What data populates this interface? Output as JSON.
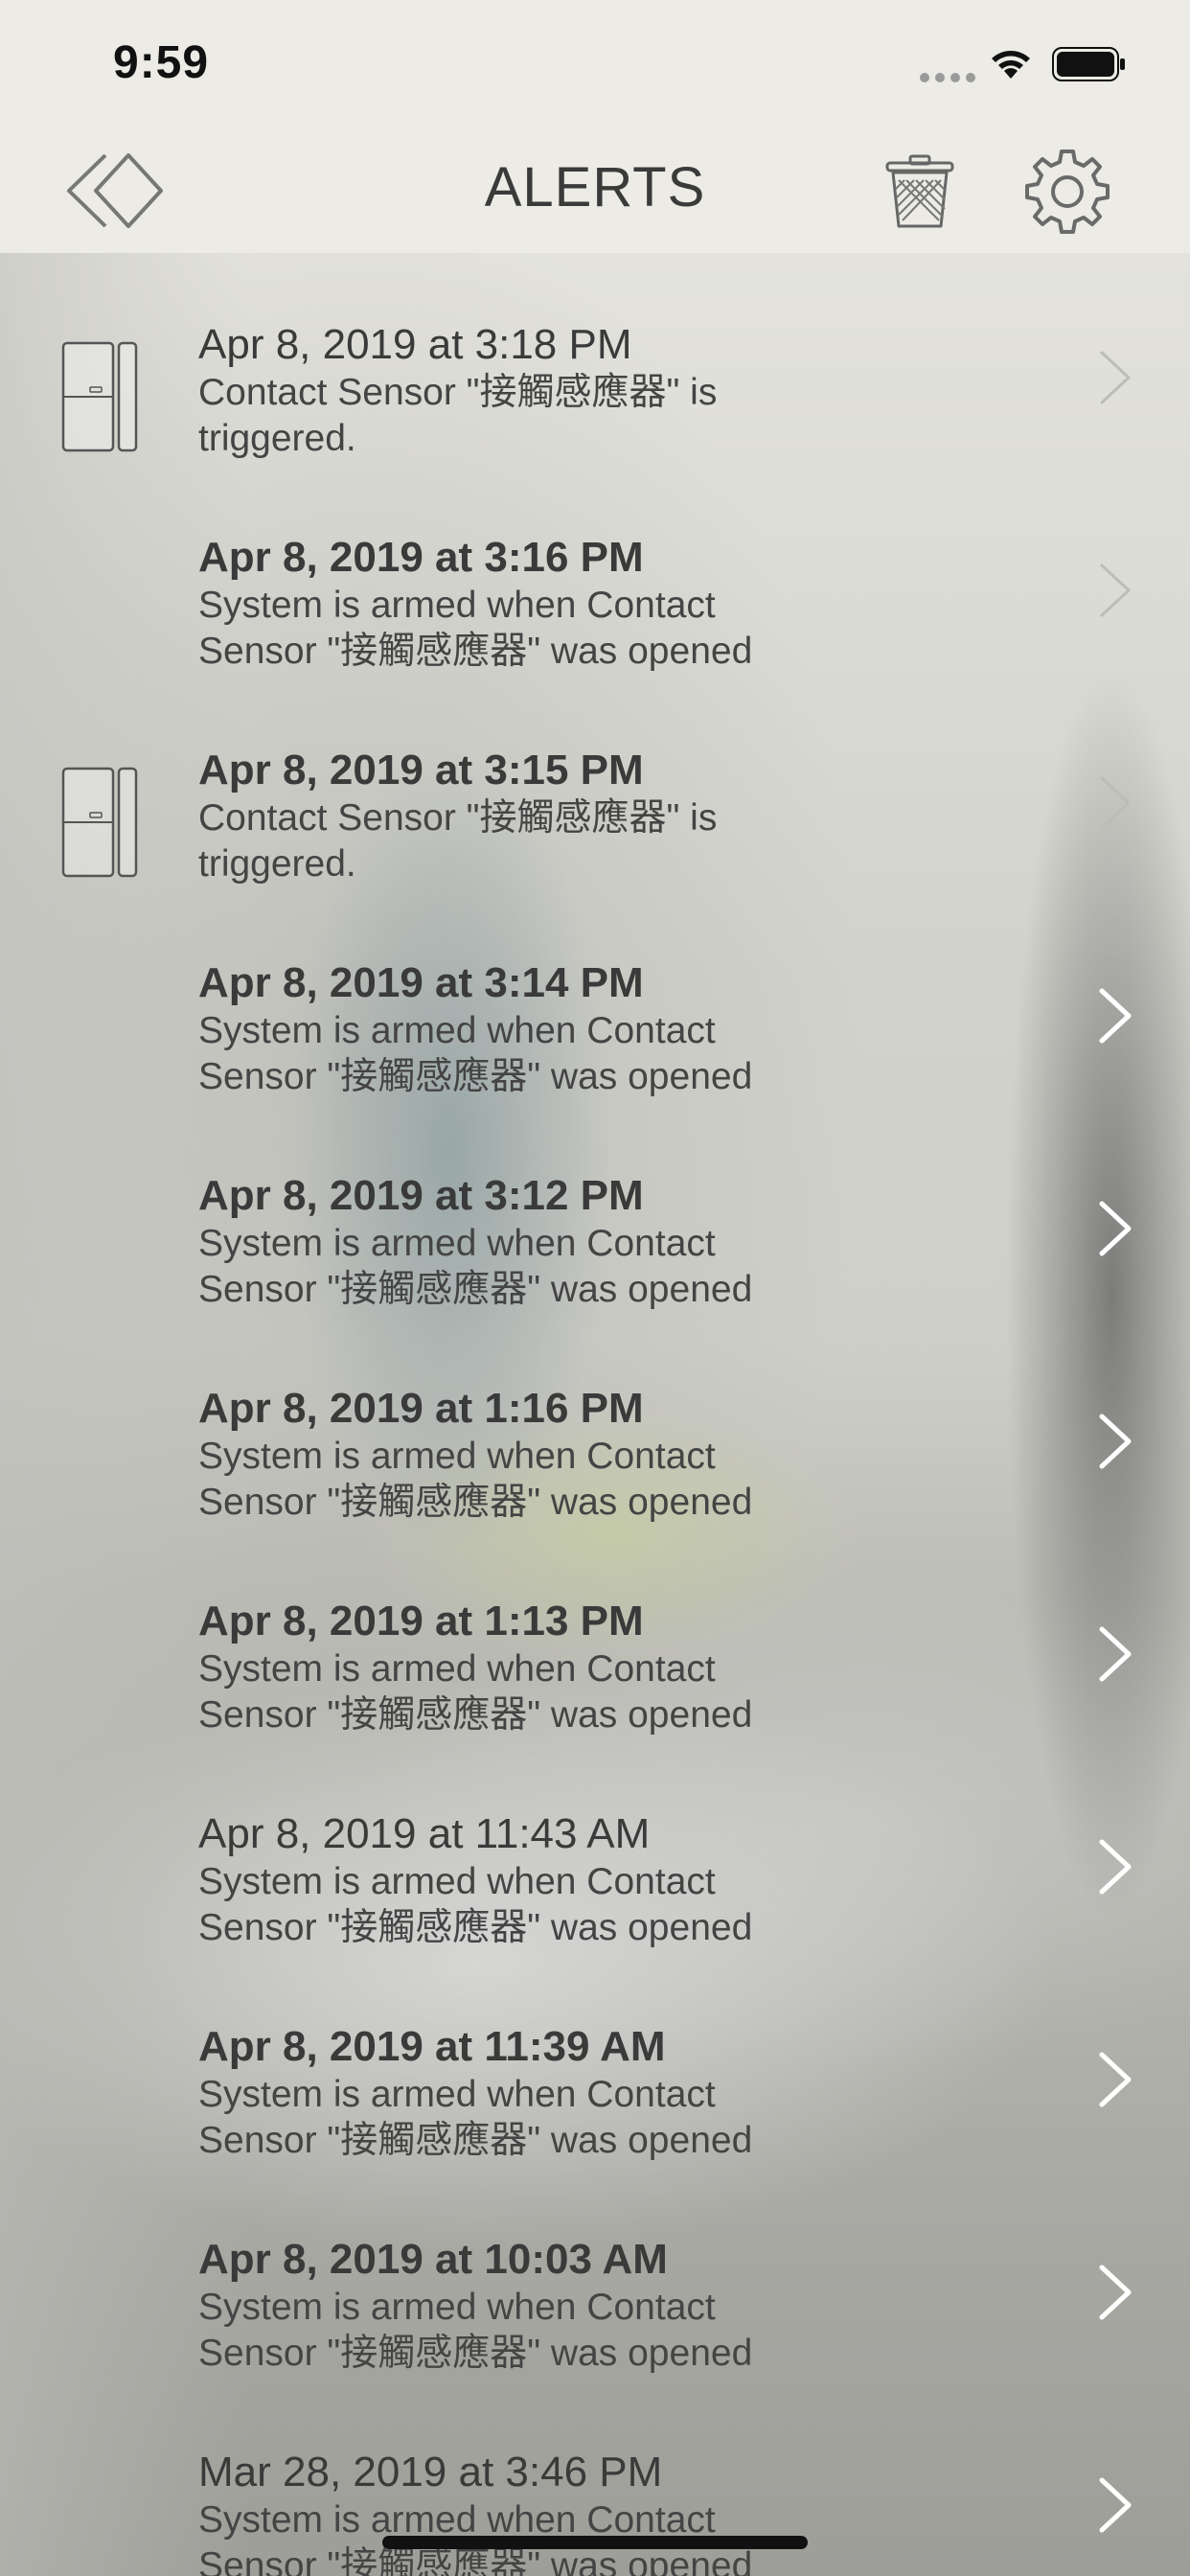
{
  "status_bar": {
    "time": "9:59"
  },
  "navbar": {
    "title": "ALERTS"
  },
  "alerts": [
    {
      "date": "Apr 8, 2019 at 3:18 PM",
      "message": "Contact Sensor \"接觸感應器\" is triggered.",
      "unread": false,
      "icon": "contact-sensor-icon"
    },
    {
      "date": "Apr 8, 2019 at 3:16 PM",
      "message": "System is armed when Contact Sensor \"接觸感應器\" was opened",
      "unread": true,
      "icon": ""
    },
    {
      "date": "Apr 8, 2019 at 3:15 PM",
      "message": "Contact Sensor \"接觸感應器\" is triggered.",
      "unread": true,
      "icon": "contact-sensor-icon"
    },
    {
      "date": "Apr 8, 2019 at 3:14 PM",
      "message": "System is armed when Contact Sensor \"接觸感應器\" was opened",
      "unread": true,
      "icon": ""
    },
    {
      "date": "Apr 8, 2019 at 3:12 PM",
      "message": "System is armed when Contact Sensor \"接觸感應器\" was opened",
      "unread": true,
      "icon": ""
    },
    {
      "date": "Apr 8, 2019 at 1:16 PM",
      "message": "System is armed when Contact Sensor \"接觸感應器\" was opened",
      "unread": true,
      "icon": ""
    },
    {
      "date": "Apr 8, 2019 at 1:13 PM",
      "message": "System is armed when Contact Sensor \"接觸感應器\" was opened",
      "unread": true,
      "icon": ""
    },
    {
      "date": "Apr 8, 2019 at 11:43 AM",
      "message": "System is armed when Contact Sensor \"接觸感應器\" was opened",
      "unread": false,
      "icon": ""
    },
    {
      "date": "Apr 8, 2019 at 11:39 AM",
      "message": "System is armed when Contact Sensor \"接觸感應器\" was opened",
      "unread": true,
      "icon": ""
    },
    {
      "date": "Apr 8, 2019 at 10:03 AM",
      "message": "System is armed when Contact Sensor \"接觸感應器\" was opened",
      "unread": true,
      "icon": ""
    },
    {
      "date": "Mar 28, 2019 at 3:46 PM",
      "message": "System is armed when Contact Sensor \"接觸感應器\" was opened",
      "unread": false,
      "icon": ""
    }
  ]
}
